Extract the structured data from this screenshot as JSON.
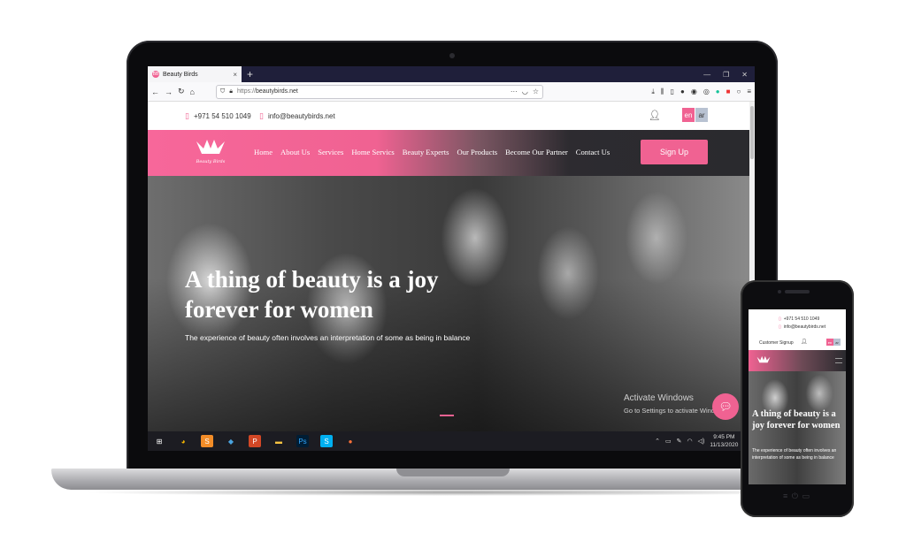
{
  "browser": {
    "tab_title": "Beauty Birds",
    "tab_favicon": "BB",
    "new_tab": "+",
    "url_prefix": "https://",
    "url_host": "beautybirds.net"
  },
  "site": {
    "phone": "+971 54 510 1049",
    "email": "info@beautybirds.net",
    "lang_en": "en",
    "lang_ar": "ar",
    "logo_text": "Beauty Birds",
    "menu": [
      "Home",
      "About Us",
      "Services",
      "Home Servics",
      "Beauty Experts",
      "Our Products",
      "Become Our Partner",
      "Contact Us"
    ],
    "signup": "Sign Up",
    "hero_title": "A thing of beauty is a joy forever for women",
    "hero_sub": "The experience of beauty often involves an interpretation of some as being in balance",
    "brand_color": "#f06292"
  },
  "os": {
    "activate_title": "Activate Windows",
    "activate_sub": "Go to Settings to activate Windows.",
    "time": "9:45 PM",
    "date": "11/13/2020"
  },
  "phone_site": {
    "phone": "+971 54 510 1049",
    "email": "info@beautybirds.net",
    "customer_signup": "Customer Signup",
    "lang_en": "en",
    "lang_ar": "ar",
    "hero_title": "A thing of beauty is a joy forever for women",
    "hero_sub": "The experience of beauty often involves an interpretation of some as being in balance"
  }
}
